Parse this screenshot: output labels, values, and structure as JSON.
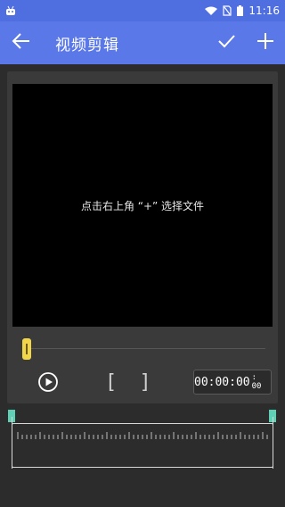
{
  "status": {
    "time": "11:16",
    "icons": [
      "android-icon",
      "wifi-icon",
      "no-sim-icon",
      "battery-icon"
    ]
  },
  "appbar": {
    "title": "视频剪辑",
    "back_icon": "arrow-left-icon",
    "confirm_icon": "checkmark-icon",
    "add_icon": "plus-icon"
  },
  "preview": {
    "hint": "点击右上角 “+” 选择文件"
  },
  "controls": {
    "play_icon": "play-icon",
    "bracket_start": "[",
    "bracket_end": "]",
    "time_main": "00:00:00",
    "time_sub": ": 00"
  },
  "colors": {
    "appbar": "#5b78e8",
    "statusbar": "#4f6ee0",
    "background": "#2c2c2c",
    "panel": "#3a3a3a",
    "handle": "#f1d64a",
    "marker": "#5fd0b5"
  }
}
